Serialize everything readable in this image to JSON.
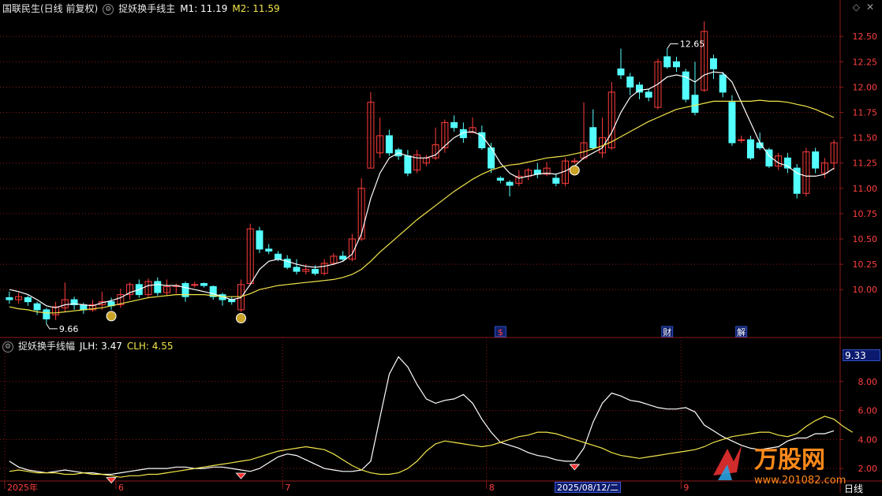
{
  "header": {
    "stock_name": "国联民生(日线 前复权)",
    "indicator_name": "捉妖换手线主",
    "m1_label": "M1: 11.19",
    "m2_label": "M2: 11.59"
  },
  "sub_header": {
    "indicator_name": "捉妖换手线幅",
    "jlh_label": "JLH: 3.47",
    "clh_label": "CLH: 4.55"
  },
  "corner_icons": [
    "diamond-icon",
    "x-icon"
  ],
  "period_label": "日线",
  "selected_value": "9.33",
  "selected_date": "2025/08/12/二",
  "colors": {
    "up": "#ff3c3c",
    "down": "#54ffff",
    "m1": "#ffffff",
    "m2": "#f2e64a",
    "grid": "#8b1a1a",
    "axis_text": "#ff4040",
    "marker": "#ff3030"
  },
  "watermark": {
    "text": "万股网",
    "url": "www.201082.com"
  },
  "chart_data": [
    {
      "type": "candlestick",
      "title": "国联民生(日线 前复权)",
      "ylim": [
        9.55,
        12.72
      ],
      "yticks": [
        10.0,
        10.25,
        10.5,
        10.75,
        11.0,
        11.25,
        11.5,
        11.75,
        12.0,
        12.25,
        12.5
      ],
      "ytick_labels": [
        "10.00",
        "10.25",
        "10.50",
        "10.75",
        "11.00",
        "11.25",
        "11.50",
        "11.75",
        "12.00",
        "12.25",
        "12.50"
      ],
      "xtick_labels": [
        "2025年",
        "6",
        "7",
        "8",
        "9"
      ],
      "xtick_index": [
        0,
        12,
        30,
        52,
        73
      ],
      "annotations": {
        "high": "12.65",
        "low": "9.66",
        "high_index": 71,
        "low_index": 4
      },
      "event_markers": [
        {
          "label": "$",
          "index": 53
        },
        {
          "label": "财",
          "index": 71
        },
        {
          "label": "解",
          "index": 79
        }
      ],
      "signal_markers": [
        11,
        25,
        61
      ],
      "candles": [
        [
          9.92,
          9.9,
          9.98,
          9.86
        ],
        [
          9.9,
          9.93,
          9.97,
          9.86
        ],
        [
          9.92,
          9.88,
          9.94,
          9.84
        ],
        [
          9.86,
          9.8,
          9.88,
          9.75
        ],
        [
          9.8,
          9.71,
          9.82,
          9.66
        ],
        [
          9.75,
          9.83,
          9.88,
          9.7
        ],
        [
          9.82,
          9.9,
          10.07,
          9.78
        ],
        [
          9.9,
          9.85,
          9.93,
          9.8
        ],
        [
          9.85,
          9.8,
          9.87,
          9.76
        ],
        [
          9.8,
          9.85,
          9.9,
          9.78
        ],
        [
          9.85,
          9.88,
          9.98,
          9.8
        ],
        [
          9.88,
          9.84,
          9.92,
          9.8
        ],
        [
          9.85,
          9.95,
          10.01,
          9.82
        ],
        [
          9.95,
          10.05,
          10.07,
          9.9
        ],
        [
          10.05,
          9.95,
          10.1,
          9.92
        ],
        [
          9.95,
          10.08,
          10.11,
          9.92
        ],
        [
          10.08,
          9.97,
          10.12,
          9.94
        ],
        [
          9.97,
          10.03,
          10.1,
          9.94
        ],
        [
          10.03,
          10.04,
          10.06,
          9.96
        ],
        [
          10.06,
          9.93,
          10.08,
          9.88
        ],
        [
          10.05,
          10.05,
          10.08,
          10.02
        ],
        [
          10.06,
          10.04,
          10.07,
          10.02
        ],
        [
          10.03,
          9.93,
          10.04,
          9.9
        ],
        [
          9.95,
          9.9,
          9.97,
          9.84
        ],
        [
          9.9,
          9.88,
          9.93,
          9.85
        ],
        [
          9.8,
          10.05,
          10.1,
          9.78
        ],
        [
          10.06,
          10.6,
          10.65,
          10.04
        ],
        [
          10.58,
          10.4,
          10.62,
          10.36
        ],
        [
          10.4,
          10.38,
          10.45,
          10.35
        ],
        [
          10.35,
          10.3,
          10.38,
          10.28
        ],
        [
          10.3,
          10.22,
          10.34,
          10.2
        ],
        [
          10.22,
          10.18,
          10.3,
          10.15
        ],
        [
          10.18,
          10.2,
          10.25,
          10.15
        ],
        [
          10.2,
          10.16,
          10.24,
          10.14
        ],
        [
          10.16,
          10.26,
          10.3,
          10.14
        ],
        [
          10.26,
          10.33,
          10.36,
          10.24
        ],
        [
          10.33,
          10.3,
          10.38,
          10.28
        ],
        [
          10.3,
          10.5,
          10.55,
          10.28
        ],
        [
          10.5,
          11.0,
          11.1,
          10.48
        ],
        [
          11.2,
          11.85,
          11.95,
          11.2
        ],
        [
          11.35,
          11.52,
          11.7,
          11.3
        ],
        [
          11.52,
          11.35,
          11.58,
          11.32
        ],
        [
          11.38,
          11.32,
          11.4,
          11.28
        ],
        [
          11.32,
          11.15,
          11.38,
          11.12
        ],
        [
          11.18,
          11.33,
          11.38,
          11.15
        ],
        [
          11.25,
          11.3,
          11.33,
          11.22
        ],
        [
          11.3,
          11.43,
          11.6,
          11.28
        ],
        [
          11.4,
          11.65,
          11.68,
          11.35
        ],
        [
          11.65,
          11.6,
          11.72,
          11.56
        ],
        [
          11.58,
          11.5,
          11.65,
          11.45
        ],
        [
          11.55,
          11.6,
          11.7,
          11.55
        ],
        [
          11.55,
          11.4,
          11.62,
          11.38
        ],
        [
          11.4,
          11.2,
          11.45,
          11.15
        ],
        [
          11.1,
          11.08,
          11.12,
          11.05
        ],
        [
          11.06,
          11.03,
          11.08,
          10.92
        ],
        [
          11.05,
          11.12,
          11.18,
          11.02
        ],
        [
          11.12,
          11.18,
          11.2,
          11.08
        ],
        [
          11.18,
          11.14,
          11.25,
          11.1
        ],
        [
          11.14,
          11.2,
          11.26,
          11.12
        ],
        [
          11.1,
          11.05,
          11.14,
          11.02
        ],
        [
          11.05,
          11.27,
          11.3,
          11.02
        ],
        [
          11.27,
          11.27,
          11.3,
          11.24
        ],
        [
          11.3,
          11.45,
          11.85,
          11.28
        ],
        [
          11.6,
          11.4,
          11.78,
          11.38
        ],
        [
          11.35,
          11.5,
          11.7,
          11.3
        ],
        [
          11.4,
          11.95,
          12.05,
          11.38
        ],
        [
          12.18,
          12.12,
          12.38,
          12.08
        ],
        [
          12.1,
          12.0,
          12.14,
          11.92
        ],
        [
          12.02,
          11.95,
          12.05,
          11.88
        ],
        [
          11.95,
          11.9,
          11.98,
          11.86
        ],
        [
          11.8,
          12.25,
          12.28,
          11.78
        ],
        [
          12.3,
          12.2,
          12.38,
          12.18
        ],
        [
          12.25,
          12.2,
          12.3,
          12.15
        ],
        [
          12.15,
          11.88,
          12.18,
          11.85
        ],
        [
          11.92,
          11.75,
          12.25,
          11.72
        ],
        [
          11.97,
          12.55,
          12.65,
          11.95
        ],
        [
          12.28,
          12.18,
          12.32,
          12.08
        ],
        [
          12.12,
          11.95,
          12.15,
          11.9
        ],
        [
          11.85,
          11.45,
          11.92,
          11.42
        ],
        [
          11.48,
          11.48,
          11.52,
          11.45
        ],
        [
          11.48,
          11.3,
          11.52,
          11.28
        ],
        [
          11.45,
          11.4,
          11.55,
          11.38
        ],
        [
          11.38,
          11.22,
          11.4,
          11.2
        ],
        [
          11.22,
          11.32,
          11.35,
          11.18
        ],
        [
          11.3,
          11.2,
          11.35,
          11.15
        ],
        [
          11.2,
          10.95,
          11.24,
          10.9
        ],
        [
          10.95,
          11.36,
          11.4,
          10.92
        ],
        [
          11.36,
          11.2,
          11.4,
          11.15
        ],
        [
          11.15,
          11.25,
          11.3,
          11.1
        ],
        [
          11.25,
          11.45,
          11.48,
          11.18
        ]
      ],
      "m1": [
        10.0,
        9.98,
        9.95,
        9.9,
        9.84,
        9.82,
        9.85,
        9.86,
        9.85,
        9.84,
        9.87,
        9.89,
        9.92,
        9.97,
        10.0,
        10.04,
        10.05,
        10.04,
        10.04,
        10.02,
        10.0,
        9.98,
        9.96,
        9.93,
        9.9,
        9.92,
        10.05,
        10.2,
        10.28,
        10.3,
        10.28,
        10.25,
        10.23,
        10.22,
        10.23,
        10.25,
        10.28,
        10.35,
        10.55,
        10.9,
        11.15,
        11.3,
        11.35,
        11.32,
        11.3,
        11.3,
        11.33,
        11.42,
        11.5,
        11.55,
        11.56,
        11.52,
        11.4,
        11.25,
        11.15,
        11.1,
        11.12,
        11.14,
        11.15,
        11.14,
        11.17,
        11.22,
        11.3,
        11.35,
        11.4,
        11.55,
        11.75,
        11.9,
        11.97,
        11.98,
        12.03,
        12.1,
        12.12,
        12.1,
        12.05,
        12.12,
        12.15,
        12.14,
        12.05,
        11.85,
        11.65,
        11.45,
        11.32,
        11.25,
        11.22,
        11.15,
        11.12,
        11.12,
        11.14,
        11.2
      ],
      "m2": [
        9.83,
        9.81,
        9.8,
        9.78,
        9.77,
        9.77,
        9.78,
        9.79,
        9.8,
        9.81,
        9.82,
        9.84,
        9.86,
        9.88,
        9.9,
        9.92,
        9.93,
        9.94,
        9.95,
        9.95,
        9.95,
        9.95,
        9.94,
        9.93,
        9.93,
        9.93,
        9.96,
        10.0,
        10.02,
        10.04,
        10.05,
        10.06,
        10.07,
        10.08,
        10.09,
        10.1,
        10.12,
        10.15,
        10.2,
        10.28,
        10.37,
        10.45,
        10.53,
        10.61,
        10.69,
        10.76,
        10.83,
        10.9,
        10.97,
        11.03,
        11.09,
        11.14,
        11.18,
        11.21,
        11.23,
        11.24,
        11.26,
        11.28,
        11.3,
        11.31,
        11.32,
        11.34,
        11.36,
        11.39,
        11.42,
        11.46,
        11.51,
        11.56,
        11.61,
        11.66,
        11.7,
        11.74,
        11.78,
        11.8,
        11.82,
        11.84,
        11.86,
        11.86,
        11.86,
        11.86,
        11.86,
        11.87,
        11.86,
        11.86,
        11.85,
        11.83,
        11.81,
        11.78,
        11.74,
        11.7
      ]
    },
    {
      "type": "line",
      "title": "捉妖换手线幅",
      "ylim": [
        1.3,
        10.0
      ],
      "yticks": [
        2.0,
        4.0,
        6.0,
        8.0
      ],
      "ytick_labels": [
        "2.00",
        "4.00",
        "6.00",
        "8.00"
      ],
      "signal_markers": [
        11,
        25,
        61
      ],
      "series": [
        {
          "name": "JLH",
          "values": [
            2.5,
            2.1,
            1.9,
            1.8,
            1.7,
            1.8,
            1.9,
            1.8,
            1.7,
            1.7,
            1.6,
            1.6,
            1.7,
            1.8,
            1.9,
            2.0,
            2.0,
            2.0,
            2.1,
            2.1,
            2.0,
            2.0,
            2.1,
            2.1,
            2.0,
            1.9,
            1.8,
            2.0,
            2.4,
            2.8,
            3.0,
            2.9,
            2.6,
            2.3,
            2.0,
            1.9,
            1.8,
            1.8,
            1.9,
            2.5,
            5.5,
            8.5,
            9.7,
            9.0,
            7.8,
            6.8,
            6.5,
            6.7,
            6.8,
            7.1,
            6.5,
            5.4,
            4.5,
            3.8,
            3.6,
            3.4,
            3.1,
            2.9,
            2.8,
            2.6,
            2.5,
            2.5,
            3.4,
            5.2,
            6.5,
            7.2,
            7.0,
            6.7,
            6.6,
            6.4,
            6.2,
            6.1,
            6.1,
            6.2,
            5.9,
            5.0,
            4.6,
            4.2,
            3.9,
            3.6,
            3.4,
            3.3,
            3.4,
            3.5,
            3.9,
            4.1,
            4.1,
            4.4,
            4.4,
            4.6
          ]
        },
        {
          "name": "CLH",
          "values": [
            1.8,
            1.9,
            1.8,
            1.7,
            1.7,
            1.7,
            1.6,
            1.6,
            1.7,
            1.6,
            1.6,
            1.5,
            1.4,
            1.5,
            1.5,
            1.6,
            1.6,
            1.7,
            1.8,
            1.9,
            2.0,
            2.1,
            2.2,
            2.3,
            2.4,
            2.5,
            2.6,
            2.8,
            3.0,
            3.2,
            3.3,
            3.4,
            3.5,
            3.4,
            3.3,
            3.0,
            2.6,
            2.2,
            1.9,
            1.7,
            1.6,
            1.6,
            1.7,
            2.0,
            2.5,
            3.2,
            3.7,
            3.9,
            3.8,
            3.7,
            3.6,
            3.5,
            3.6,
            3.8,
            4.0,
            4.2,
            4.3,
            4.5,
            4.5,
            4.4,
            4.2,
            4.0,
            3.8,
            3.6,
            3.4,
            3.1,
            2.9,
            2.8,
            2.7,
            2.8,
            2.9,
            3.0,
            3.1,
            3.2,
            3.3,
            3.5,
            3.8,
            4.0,
            4.2,
            4.3,
            4.4,
            4.5,
            4.5,
            4.3,
            4.2,
            4.4,
            4.9,
            5.3,
            5.6,
            5.4,
            4.9,
            4.5
          ]
        }
      ]
    }
  ]
}
